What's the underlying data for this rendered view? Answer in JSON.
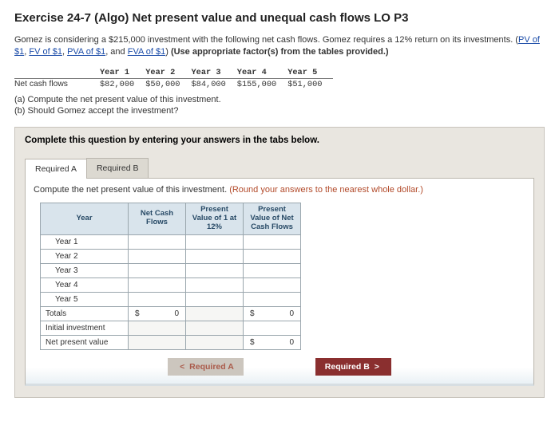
{
  "title": "Exercise 24-7 (Algo) Net present value and unequal cash flows LO P3",
  "intro": {
    "line1_a": "Gomez is considering a $215,000 investment with the following net cash flows. Gomez requires a 12% return on its investments. (",
    "link_pv": "PV of $1",
    "sep1": ", ",
    "link_fv": "FV of $1",
    "sep2": ", ",
    "link_pva": "PVA of $1",
    "sep3": ", and ",
    "link_fva": "FVA of $1",
    "line1_b": ") ",
    "bold": "(Use appropriate factor(s) from the tables provided.)"
  },
  "cashflows": {
    "label": "Net cash flows",
    "headers": [
      "Year 1",
      "Year 2",
      "Year 3",
      "Year 4",
      "Year 5"
    ],
    "values": [
      "$82,000",
      "$50,000",
      "$84,000",
      "$155,000",
      "$51,000"
    ]
  },
  "questions": {
    "a": "(a) Compute the net present value of this investment.",
    "b": "(b) Should Gomez accept the investment?"
  },
  "panel": {
    "instr": "Complete this question by entering your answers in the tabs below.",
    "tabA": "Required A",
    "tabB": "Required B",
    "subinstr_plain": "Compute the net present value of this investment. ",
    "subinstr_round": "(Round your answers to the nearest whole dollar.)"
  },
  "worksheet": {
    "cols": [
      "Year",
      "Net Cash Flows",
      "Present Value of 1 at 12%",
      "Present Value of Net Cash Flows"
    ],
    "rows": [
      "Year 1",
      "Year 2",
      "Year 3",
      "Year 4",
      "Year 5"
    ],
    "totals_label": "Totals",
    "initial_label": "Initial investment",
    "npv_label": "Net present value",
    "totals_ncf": "0",
    "totals_pvncf": "0",
    "npv_value": "0"
  },
  "nav": {
    "prev": "Required A",
    "next": "Required B"
  }
}
